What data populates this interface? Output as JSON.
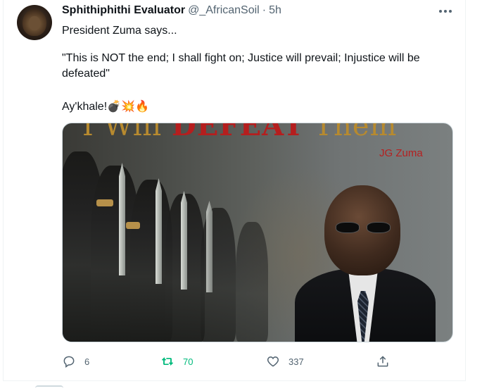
{
  "tweet": {
    "display_name": "Sphithiphithi Evaluator",
    "handle": "@_AfricanSoil",
    "separator": "·",
    "time": "5h",
    "lines": [
      "President Zuma says...",
      "\"This is NOT the end; I shall fight on; Justice will prevail; Injustice will be defeated\"",
      "Ay'khale!💣💥🔥"
    ],
    "media": {
      "caption_parts": [
        "I Will ",
        "DEFEAT",
        " Them"
      ],
      "attribution": "JG Zuma"
    },
    "actions": {
      "reply_count": "6",
      "retweet_count": "70",
      "like_count": "337"
    }
  },
  "colors": {
    "text_primary": "#0f1419",
    "text_secondary": "#536471",
    "retweet_active": "#00ba7c",
    "border": "#eff3f4"
  },
  "icons": [
    "more-icon",
    "reply-icon",
    "retweet-icon",
    "like-icon",
    "share-icon"
  ]
}
